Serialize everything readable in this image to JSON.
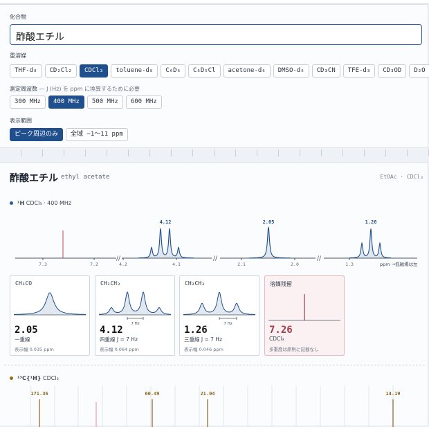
{
  "compound": {
    "label": "化合物",
    "value": "酢酸エチル"
  },
  "solvent": {
    "label": "重溶媒",
    "options": [
      "THF-d₈",
      "CD₂Cl₂",
      "CDCl₃",
      "toluene-d₈",
      "C₆D₆",
      "C₆D₅Cl",
      "acetone-d₆",
      "DMSO-d₆",
      "CD₃CN",
      "TFE-d₃",
      "CD₃OD",
      "D₂O"
    ],
    "selected": "CDCl₃"
  },
  "frequency": {
    "label": "測定周波数",
    "hint": "— J (Hz) を ppm に換算するために必要",
    "options": [
      "300 MHz",
      "400 MHz",
      "500 MHz",
      "600 MHz"
    ],
    "selected": "400 MHz"
  },
  "range": {
    "label": "表示範囲",
    "options": [
      "ピーク周辺のみ",
      "全域 −1〜11 ppm"
    ],
    "selected": "ピーク周辺のみ"
  },
  "result": {
    "title": "酢酸エチル",
    "subtitle": "ethyl acetate",
    "abbr": "EtOAc · CDCl₃"
  },
  "h1": {
    "heading": "¹H",
    "heading_rest": "CDCl₃ · 400 MHz",
    "dot_color": "#2a5aa0",
    "peak_color": "#1f4f8c",
    "solvent_color": "#c0485a",
    "axis_note": "ppm →低磁場は左",
    "chart_data": {
      "type": "line",
      "segments": [
        {
          "ticks": [
            "7.3",
            "7.2"
          ],
          "solvent_peak": 7.26
        },
        {
          "ticks": [
            "4.2",
            "4.1"
          ],
          "peak_label": "4.12",
          "peak": 4.12,
          "multiplicity": "q"
        },
        {
          "ticks": [
            "2.1",
            "2.0"
          ],
          "peak_label": "2.05",
          "peak": 2.05,
          "multiplicity": "s"
        },
        {
          "ticks": [
            "1.3"
          ],
          "peak_label": "1.26",
          "peak": 1.26,
          "multiplicity": "t"
        }
      ]
    },
    "cards": [
      {
        "group": "CH₃CO",
        "shift": "2.05",
        "mult": "一重線",
        "j": "",
        "width": "表示幅 0.035 ppm",
        "shape": "s"
      },
      {
        "group": "CH₂CH₃",
        "shift": "4.12",
        "mult": "四重線",
        "j": "J = 7 Hz",
        "width": "表示幅 0.064 ppm",
        "shape": "q",
        "jbar": "7 Hz"
      },
      {
        "group": "CH₂CH₃",
        "shift": "1.26",
        "mult": "三重線",
        "j": "J = 7 Hz",
        "width": "表示幅 0.046 ppm",
        "shape": "t",
        "jbar": "7 Hz"
      },
      {
        "group": "溶媒残留",
        "shift": "7.26",
        "mult": "CDCl₃",
        "j": "",
        "width": "多重度は原則に記載なし",
        "shape": "solv"
      }
    ]
  },
  "c13": {
    "heading": "¹³C{¹H}",
    "heading_rest": "CDCl₃",
    "dot_color": "#9a6a1c",
    "line_color": "#8a6420",
    "solvent_color": "#e08a96",
    "chart_data": {
      "type": "bar",
      "peaks": [
        "171.36",
        "60.49",
        "21.04",
        "14.19"
      ]
    }
  }
}
